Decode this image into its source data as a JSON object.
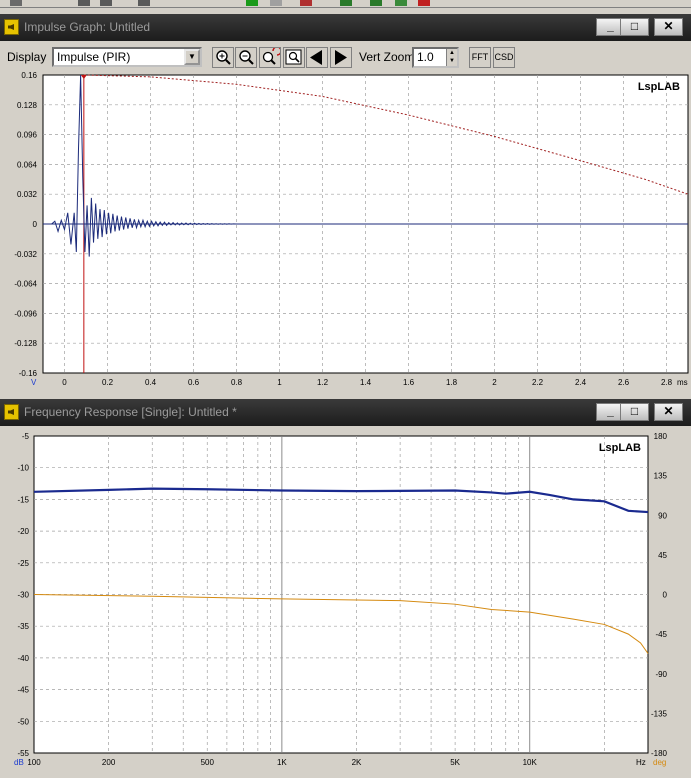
{
  "impulse_window": {
    "title": "Impulse Graph: Untitled",
    "controls": {
      "display_label": "Display",
      "display_value": "Impulse (PIR)",
      "vert_zoom_label": "Vert Zoom",
      "vert_zoom_value": "1.0",
      "fft_label": "FFT",
      "csd_label": "CSD"
    },
    "icons": [
      "zoom-in-icon",
      "zoom-out-icon",
      "zoom-refresh-icon",
      "zoom-fit-icon",
      "arrow-left-icon",
      "arrow-right-icon"
    ],
    "watermark": "LspLAB"
  },
  "frequency_window": {
    "title": "Frequency Response [Single]: Untitled *",
    "watermark": "LspLAB"
  },
  "window_buttons": {
    "minimize": "_",
    "maximize": "□",
    "close": "✕"
  },
  "colors": {
    "impulse": "#1b2a7a",
    "envelope": "#a02020",
    "marker": "#c01010",
    "magnitude": "#1a2a8f",
    "phase": "#d58a10",
    "grid": "#a0a0a0",
    "plot_bg": "#ffffff"
  },
  "chart_data": [
    {
      "type": "line",
      "title": "",
      "xlabel": "ms",
      "ylabel": "V",
      "xlim": [
        -0.1,
        2.9
      ],
      "ylim": [
        -0.16,
        0.16
      ],
      "x_ticks": [
        "0",
        "0.2",
        "0.4",
        "0.6",
        "0.8",
        "1",
        "1.2",
        "1.4",
        "1.6",
        "1.8",
        "2",
        "2.2",
        "2.4",
        "2.6",
        "2.8"
      ],
      "x_tick_values": [
        0,
        0.2,
        0.4,
        0.6,
        0.8,
        1,
        1.2,
        1.4,
        1.6,
        1.8,
        2,
        2.2,
        2.4,
        2.6,
        2.8
      ],
      "y_ticks": [
        "0.16",
        "0.128",
        "0.096",
        "0.064",
        "0.032",
        "0",
        "-0.032",
        "-0.064",
        "-0.096",
        "-0.128",
        "-0.16"
      ],
      "y_tick_values": [
        0.16,
        0.128,
        0.096,
        0.064,
        0.032,
        0,
        -0.032,
        -0.064,
        -0.096,
        -0.128,
        -0.16
      ],
      "marker_x": 0.09,
      "series": [
        {
          "style": "solid",
          "x": [
            -0.1,
            -0.06,
            -0.045,
            -0.03,
            -0.015,
            0.0,
            0.015,
            0.03,
            0.045,
            0.055,
            0.065,
            0.075,
            0.085,
            0.095,
            0.105,
            0.115,
            0.125,
            0.135,
            0.145,
            0.155,
            0.165,
            0.175,
            0.185,
            0.195,
            0.205,
            0.215,
            0.225,
            0.235,
            0.245,
            0.255,
            0.265,
            0.275,
            0.285,
            0.295,
            0.305,
            0.315,
            0.325,
            0.335,
            0.345,
            0.355,
            0.365,
            0.375,
            0.385,
            0.395,
            0.405,
            0.415,
            0.425,
            0.435,
            0.445,
            0.455,
            0.465,
            0.475,
            0.485,
            0.495,
            0.505,
            0.515,
            0.525,
            0.535,
            0.545,
            0.555,
            0.565,
            0.575,
            0.585,
            0.595,
            0.605,
            0.615,
            0.625,
            0.635,
            0.645,
            0.655,
            0.665,
            0.675,
            0.685,
            0.695,
            0.705,
            0.715,
            0.725,
            0.735,
            0.745,
            0.755,
            0.765,
            0.775,
            0.785,
            0.8,
            0.85,
            0.9,
            1.0,
            2.9
          ],
          "y": [
            0,
            0,
            0.003,
            -0.008,
            0.004,
            -0.006,
            0.012,
            -0.022,
            0.012,
            -0.03,
            0.08,
            0.16,
            0.05,
            -0.03,
            0.02,
            -0.035,
            0.028,
            -0.02,
            0.022,
            -0.016,
            0.016,
            -0.014,
            0.015,
            -0.011,
            0.012,
            -0.01,
            0.011,
            -0.008,
            0.009,
            -0.007,
            0.008,
            -0.006,
            0.007,
            -0.005,
            0.006,
            -0.004,
            0.005,
            -0.004,
            0.004,
            -0.003,
            0.004,
            -0.003,
            0.003,
            -0.0025,
            0.003,
            -0.002,
            0.0025,
            -0.002,
            0.002,
            -0.0015,
            0.002,
            -0.0015,
            0.0015,
            -0.001,
            0.0015,
            -0.001,
            0.0012,
            -0.001,
            0.001,
            -0.0008,
            0.001,
            -0.0008,
            0.0008,
            -0.0006,
            0.0008,
            -0.0006,
            0.0006,
            -0.0005,
            0.0005,
            -0.0004,
            0.0005,
            -0.0004,
            0.0004,
            -0.0003,
            0.0003,
            -0.0003,
            0.0003,
            -0.0002,
            0.0002,
            -0.0002,
            0.0002,
            -0.0001,
            0.0001,
            0,
            0,
            0,
            0,
            0
          ]
        },
        {
          "style": "dotted",
          "x": [
            0.09,
            0.4,
            0.8,
            1.2,
            1.6,
            2.0,
            2.4,
            2.7,
            2.9
          ],
          "y": [
            0.16,
            0.158,
            0.15,
            0.137,
            0.117,
            0.094,
            0.068,
            0.048,
            0.032
          ]
        }
      ]
    },
    {
      "type": "line",
      "title": "",
      "xlabel": "Hz",
      "ylabel": "dB",
      "y2label": "deg",
      "xscale": "log",
      "xlim": [
        100,
        30000
      ],
      "ylim": [
        -55,
        -5
      ],
      "y2lim": [
        -180,
        180
      ],
      "x_ticks": [
        "100",
        "200",
        "500",
        "1K",
        "2K",
        "5K",
        "10K"
      ],
      "x_tick_values": [
        100,
        200,
        500,
        1000,
        2000,
        5000,
        10000
      ],
      "y_ticks": [
        "-5",
        "-10",
        "-15",
        "-20",
        "-25",
        "-30",
        "-35",
        "-40",
        "-45",
        "-50",
        "-55"
      ],
      "y_tick_values": [
        -5,
        -10,
        -15,
        -20,
        -25,
        -30,
        -35,
        -40,
        -45,
        -50,
        -55
      ],
      "y2_ticks": [
        "180",
        "135",
        "90",
        "45",
        "0",
        "-45",
        "-90",
        "-135",
        "-180"
      ],
      "y2_tick_values": [
        180,
        135,
        90,
        45,
        0,
        -45,
        -90,
        -135,
        -180
      ],
      "series": [
        {
          "axis": "left",
          "x": [
            100,
            200,
            300,
            500,
            1000,
            2000,
            5000,
            7000,
            8000,
            10000,
            12000,
            15000,
            20000,
            25000,
            30000
          ],
          "y": [
            -13.8,
            -13.5,
            -13.3,
            -13.4,
            -13.6,
            -13.7,
            -13.6,
            -13.9,
            -14.1,
            -13.8,
            -14.3,
            -15.0,
            -15.3,
            -16.8,
            -17.0
          ],
          "color": "#1a2a8f"
        },
        {
          "axis": "right",
          "x": [
            100,
            300,
            1000,
            3000,
            5000,
            7000,
            10000,
            15000,
            20000,
            25000,
            28000,
            30000
          ],
          "y": [
            0,
            -2,
            -5,
            -7,
            -11,
            -17,
            -20,
            -28,
            -34,
            -45,
            -55,
            -67
          ],
          "color": "#d58a10"
        }
      ]
    }
  ]
}
